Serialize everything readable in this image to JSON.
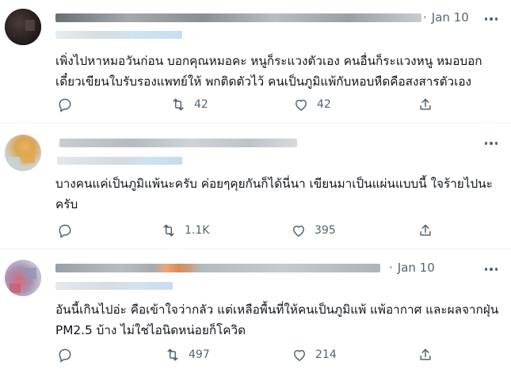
{
  "tweets": [
    {
      "date": "Jan 10",
      "text": "เพิ่งไปหาหมอวันก่อน บอกคุณหมอคะ หนูก็ระแวงตัวเอง คนอื่นก็ระแวงหนู หมอบอกเดี๋ยวเขียนใบรับรองแพทย์ให้ พกติดตัวไว้ คนเป็นภูมิแพ้กับหอบหืดคือสงสารตัวเอง",
      "reply_count": "",
      "retweet_count": "42",
      "like_count": "42"
    },
    {
      "date": "",
      "text": "บางคนแค่เป็นภูมิแพ้นะครับ ค่อยๆคุยกันก็ได้นี่นา เขียนมาเป็นแผ่นแบบนี้ ใจร้ายไปนะครับ",
      "reply_count": "",
      "retweet_count": "1.1K",
      "like_count": "395"
    },
    {
      "date": "Jan 10",
      "text": "อันนี้เกินไปอ่ะ คือเข้าใจว่ากลัว แต่เหลือพื้นที่ให้คนเป็นภูมิแพ้ แพ้อากาศ และผลจากฝุ่น PM2.5 บ้าง ไม่ใช่ไอนิดหน่อยก็โควิด",
      "reply_count": "",
      "retweet_count": "497",
      "like_count": "214"
    }
  ],
  "colors": {
    "text": "#0f1419",
    "secondary": "#536471",
    "divider": "#eff3f4",
    "blur_gray": "#bfc4c8",
    "blur_blue": "#d6e8f3",
    "blur_orange": "#e6a67a"
  },
  "icons": [
    "reply-icon",
    "retweet-icon",
    "like-icon",
    "share-icon",
    "more-icon"
  ]
}
